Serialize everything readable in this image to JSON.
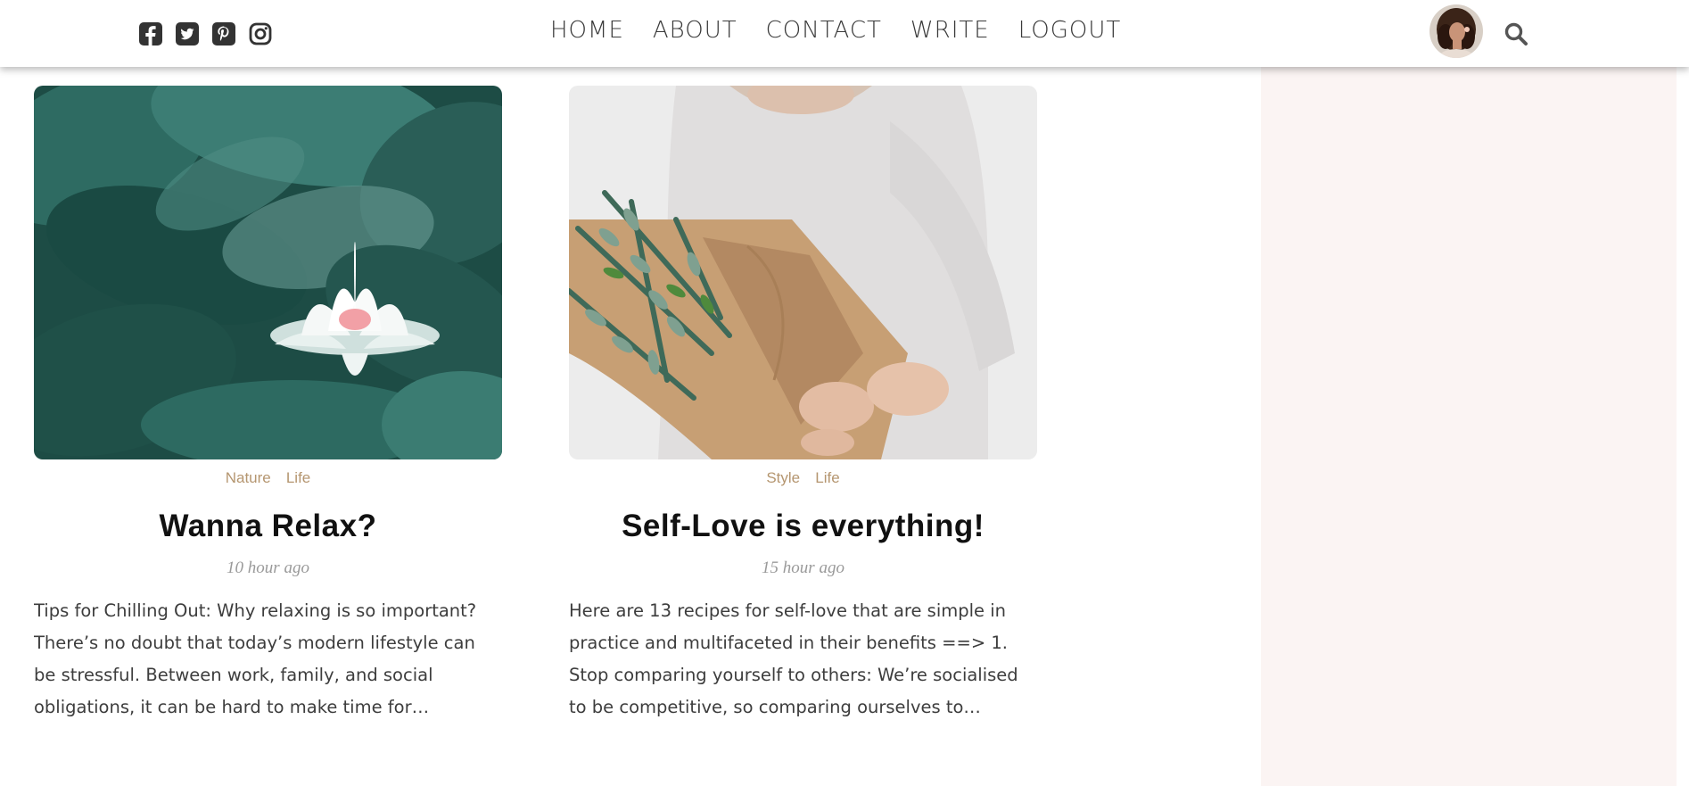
{
  "social": {
    "icons": [
      "facebook-square-icon",
      "twitter-square-icon",
      "pinterest-square-icon",
      "instagram-icon"
    ]
  },
  "nav": {
    "items": [
      "HOME",
      "ABOUT",
      "CONTACT",
      "WRITE",
      "LOGOUT"
    ]
  },
  "header": {
    "avatar_icon": "user-avatar",
    "search_icon": "search-icon"
  },
  "posts": [
    {
      "categories": [
        "Nature",
        "Life"
      ],
      "title": "Wanna Relax?",
      "date": "10 hour ago",
      "description": "Tips for Chilling Out: Why relaxing is so important? There’s no doubt that today’s modern lifestyle can be stressful. Between work, family, and social obligations, it can be hard to make time for yourself..."
    },
    {
      "categories": [
        "Style",
        "Life"
      ],
      "title": "Self-Love is everything!",
      "date": "15 hour ago",
      "description": "Here are 13 recipes for self-love that are simple in practice and multifaceted in their benefits ==> 1. Stop comparing yourself to others: We’re socialised to be competitive, so comparing ourselves to others..."
    }
  ],
  "colors": {
    "category": "#b59670",
    "sidebar_bg": "#fbf4f3",
    "nav_text": "#3a3a3a"
  }
}
